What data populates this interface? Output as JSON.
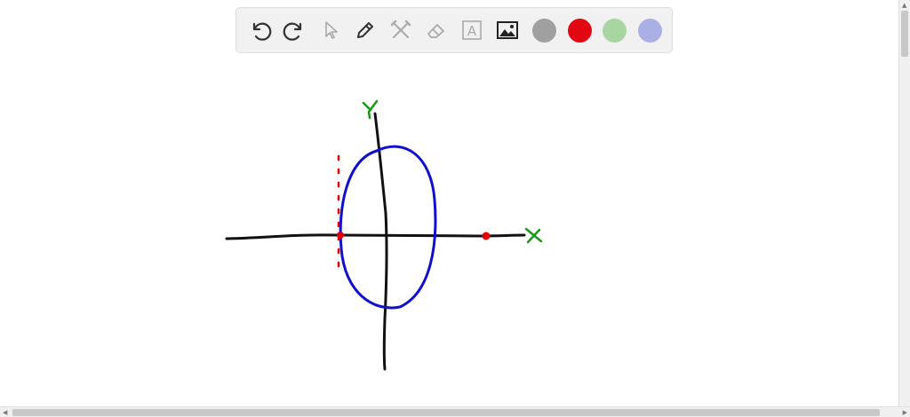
{
  "toolbar": {
    "tools": [
      {
        "name": "undo-icon",
        "active": true
      },
      {
        "name": "redo-icon",
        "active": true
      },
      {
        "name": "pointer-icon",
        "active": false
      },
      {
        "name": "pen-icon",
        "active": true
      },
      {
        "name": "tools-icon",
        "active": false
      },
      {
        "name": "eraser-icon",
        "active": false
      },
      {
        "name": "text-icon",
        "active": false
      },
      {
        "name": "image-icon",
        "active": true
      }
    ],
    "text_tool_letter": "A",
    "colors": [
      "#a0a0a0",
      "#e30613",
      "#a8d5a2",
      "#aab0e6"
    ]
  },
  "drawing": {
    "x_label": "X",
    "y_label": "Y",
    "ink_colors": {
      "axes": "#111111",
      "ellipse": "#1010cc",
      "labels": "#1a9a1a",
      "points": "#e00000"
    }
  }
}
